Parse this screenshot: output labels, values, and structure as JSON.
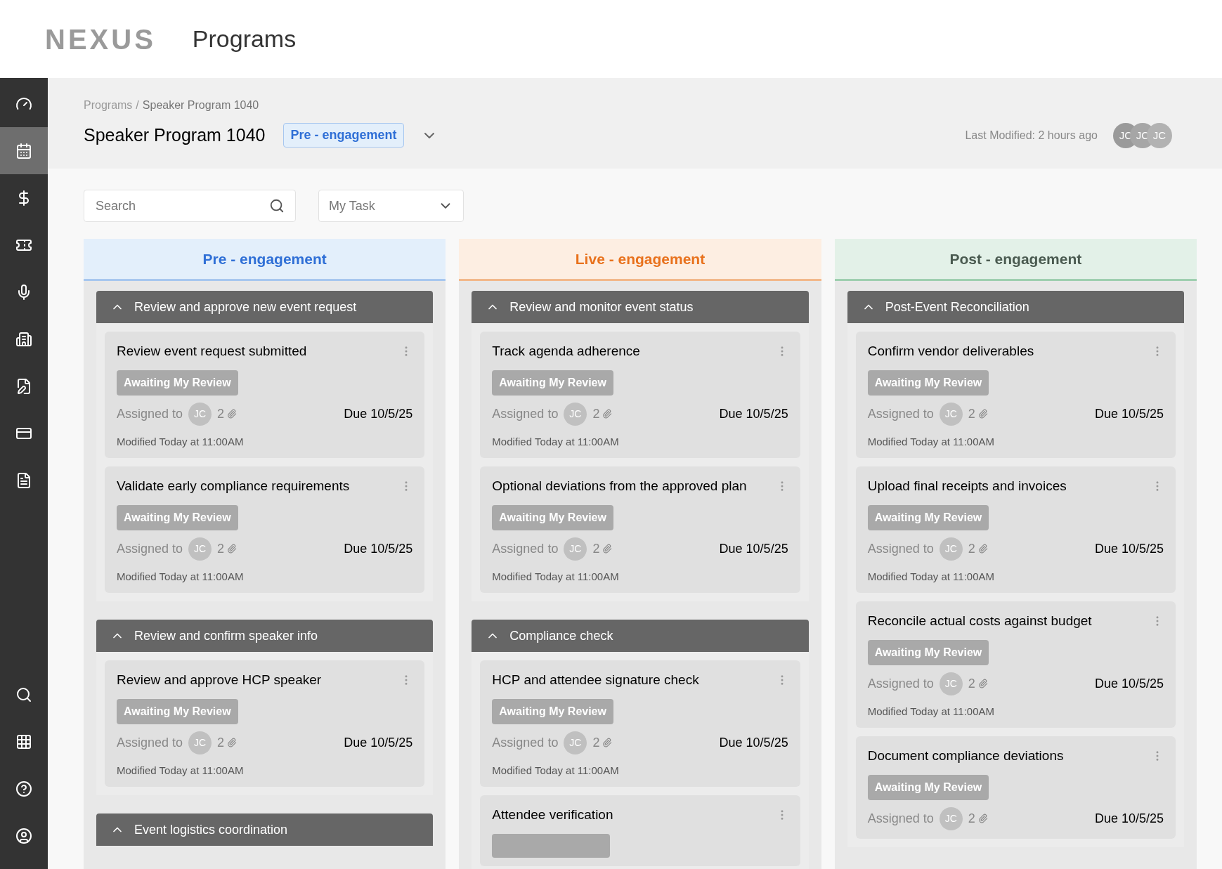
{
  "app": {
    "logo": "NEXUS",
    "title": "Programs"
  },
  "sidebar": {
    "items": [
      {
        "selected": false
      },
      {
        "selected": true
      },
      {
        "selected": false
      },
      {
        "selected": false
      },
      {
        "selected": false
      },
      {
        "selected": false
      },
      {
        "selected": false
      },
      {
        "selected": false
      },
      {
        "selected": false
      }
    ],
    "bottom_items": [
      {
        "selected": false
      },
      {
        "selected": false
      },
      {
        "selected": false
      },
      {
        "selected": false
      }
    ]
  },
  "breadcrumb": {
    "items": [
      "Programs",
      "Speaker Program 1040"
    ],
    "separator": "/"
  },
  "program": {
    "title": "Speaker Program 1040",
    "stage": "Pre - engagement",
    "last_modified": "Last Modified: 2 hours ago",
    "avatars": [
      "JC",
      "JC",
      "JC"
    ]
  },
  "filters": {
    "search": {
      "placeholder": "Search"
    },
    "view": {
      "value": "My Task"
    }
  },
  "columns": [
    {
      "kind": "pre",
      "title": "Pre - engagement",
      "color": "#2f6fd6",
      "groups": [
        {
          "title": "Review and approve new event request",
          "expanded": true,
          "cards": [
            {
              "title": "Review event request submitted",
              "badge": "Awaiting My Review",
              "assigned_label": "Assigned to",
              "assignee": "JC",
              "attachments": "2",
              "due": "Due 10/5/25",
              "modified": "Modified Today at 11:00AM"
            },
            {
              "title": "Validate early compliance requirements",
              "badge": "Awaiting My Review",
              "assigned_label": "Assigned to",
              "assignee": "JC",
              "attachments": "2",
              "due": "Due 10/5/25",
              "modified": "Modified Today at 11:00AM"
            }
          ]
        },
        {
          "title": "Review and confirm speaker info",
          "expanded": true,
          "cards": [
            {
              "title": "Review and approve HCP speaker",
              "badge": "Awaiting My Review",
              "assigned_label": "Assigned to",
              "assignee": "JC",
              "attachments": "2",
              "due": "Due 10/5/25",
              "modified": "Modified Today at 11:00AM"
            }
          ]
        },
        {
          "title": "Event logistics coordination",
          "expanded": true
        }
      ]
    },
    {
      "kind": "live",
      "title": "Live - engagement",
      "color": "#e8711c",
      "groups": [
        {
          "title": "Review and monitor event status",
          "expanded": true,
          "cards": [
            {
              "title": "Track agenda adherence",
              "badge": "Awaiting My Review",
              "assigned_label": "Assigned to",
              "assignee": "JC",
              "attachments": "2",
              "due": "Due 10/5/25",
              "modified": "Modified Today at 11:00AM"
            },
            {
              "title": "Optional deviations from the approved plan",
              "badge": "Awaiting My Review",
              "assigned_label": "Assigned to",
              "assignee": "JC",
              "attachments": "2",
              "due": "Due 10/5/25",
              "modified": "Modified Today at 11:00AM"
            }
          ]
        },
        {
          "title": "Compliance check",
          "expanded": true,
          "cards": [
            {
              "title": "HCP and attendee signature check",
              "badge": "Awaiting My Review",
              "assigned_label": "Assigned to",
              "assignee": "JC",
              "attachments": "2",
              "due": "Due 10/5/25",
              "modified": "Modified Today at 11:00AM"
            },
            {
              "title": "Attendee verification",
              "badge_cut": true
            }
          ]
        }
      ]
    },
    {
      "kind": "post",
      "title": "Post - engagement",
      "color": "#4a5a50",
      "groups": [
        {
          "title": "Post-Event Reconciliation",
          "expanded": true,
          "cards": [
            {
              "title": "Confirm vendor deliverables",
              "badge": "Awaiting My Review",
              "assigned_label": "Assigned to",
              "assignee": "JC",
              "attachments": "2",
              "due": "Due 10/5/25",
              "modified": "Modified Today at 11:00AM"
            },
            {
              "title": "Upload final receipts and invoices",
              "badge": "Awaiting My Review",
              "assigned_label": "Assigned to",
              "assignee": "JC",
              "attachments": "2",
              "due": "Due 10/5/25",
              "modified": "Modified Today at 11:00AM"
            },
            {
              "title": "Reconcile actual costs against budget",
              "badge": "Awaiting My Review",
              "assigned_label": "Assigned to",
              "assignee": "JC",
              "attachments": "2",
              "due": "Due 10/5/25",
              "modified": "Modified Today at 11:00AM"
            },
            {
              "title": "Document compliance deviations",
              "badge": "Awaiting My Review",
              "assigned_label": "Assigned to",
              "assignee": "JC",
              "attachments": "2",
              "due": "Due 10/5/25"
            }
          ]
        }
      ]
    }
  ]
}
